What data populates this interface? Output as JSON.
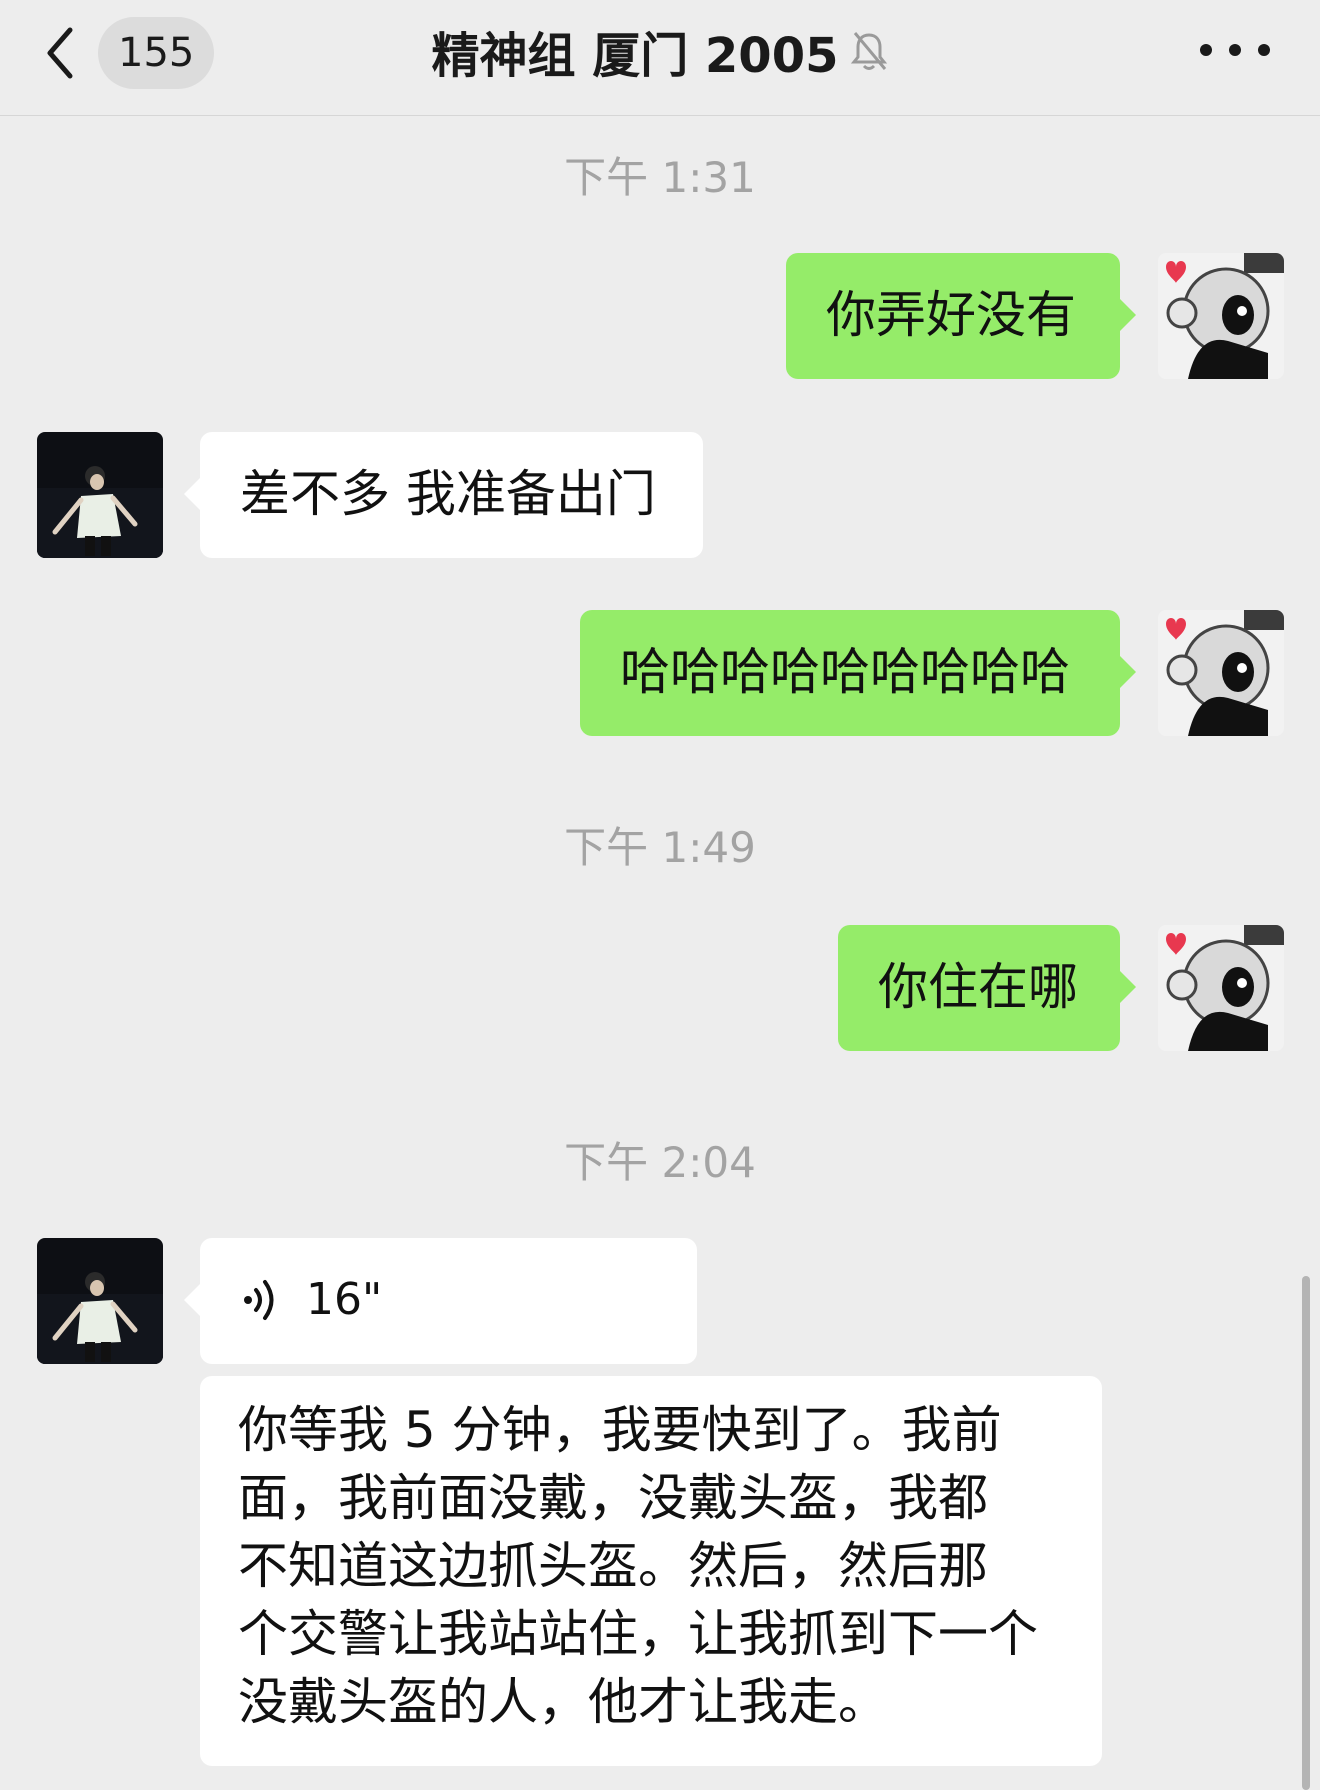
{
  "header": {
    "unread_count": "155",
    "title": "精神组 厦门 2005",
    "back_icon": "chevron-left-icon",
    "mute_icon": "bell-muted-icon",
    "more_icon": "more-dots-icon"
  },
  "colors": {
    "background": "#ededed",
    "sent_bubble": "#95ec69",
    "received_bubble": "#ffffff",
    "timestamp": "#a3a3a3"
  },
  "messages": [
    {
      "type": "time",
      "text": "下午 1:31"
    },
    {
      "type": "sent",
      "text": "你弄好没有"
    },
    {
      "type": "received",
      "text": "差不多 我准备出门"
    },
    {
      "type": "sent",
      "text": "哈哈哈哈哈哈哈哈哈"
    },
    {
      "type": "time",
      "text": "下午 1:49"
    },
    {
      "type": "sent",
      "text": "你住在哪"
    },
    {
      "type": "time",
      "text": "下午 2:04"
    },
    {
      "type": "voice",
      "duration": "16\""
    },
    {
      "type": "transcript",
      "lines": [
        "你等我 5 分钟，我要快到了。我前",
        "面，我前面没戴，没戴头盔，我都",
        "不知道这边抓头盔。然后，然后那",
        "个交警让我站站住，让我抓到下一个",
        "没戴头盔的人，他才让我走。"
      ]
    }
  ]
}
